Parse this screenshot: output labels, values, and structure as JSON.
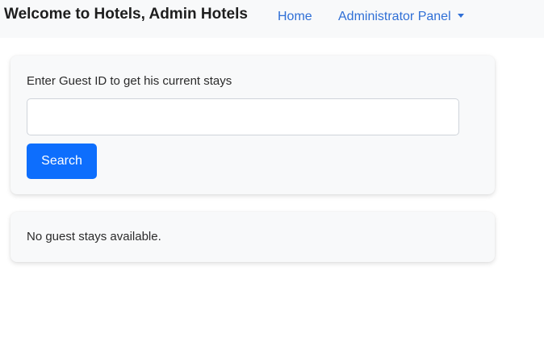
{
  "navbar": {
    "brand": "Welcome to Hotels, Admin Hotels",
    "links": {
      "home": "Home",
      "admin_panel": "Administrator Panel"
    }
  },
  "search_card": {
    "label": "Enter Guest ID to get his current stays",
    "input_value": "",
    "input_placeholder": "",
    "button_label": "Search"
  },
  "results_card": {
    "message": "No guest stays available."
  },
  "colors": {
    "navbar_bg": "#f8f9fa",
    "link": "#2f6fd6",
    "primary_button": "#0d6efd",
    "card_bg": "#f8f9fa"
  },
  "icons": {
    "admin_dropdown": "caret-down-icon"
  }
}
